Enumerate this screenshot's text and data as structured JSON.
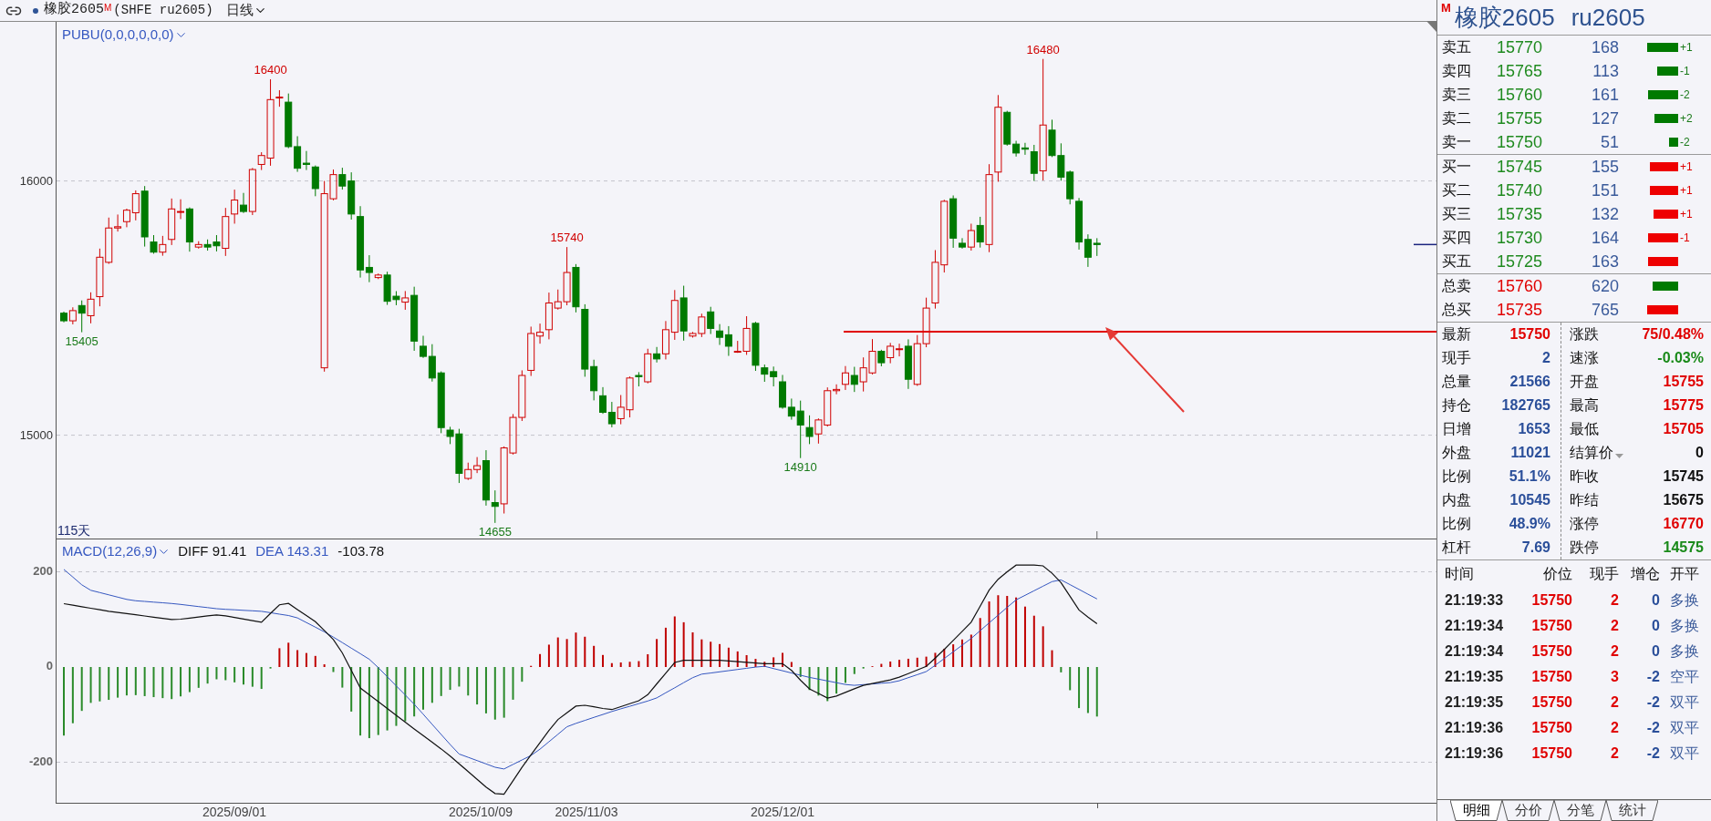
{
  "toolbar": {
    "contract": "橡胶2605",
    "market_mark": "M",
    "exchange_code": "(SHFE ru2605)",
    "period": "日线"
  },
  "price_chart": {
    "indicator": "PUBU(0,0,0,0,0,0)",
    "bar_count": "115天",
    "y_ticks": [
      "16000",
      "15000"
    ],
    "extremes": [
      {
        "text": "15405",
        "kind": "low"
      },
      {
        "text": "16400",
        "kind": "high"
      },
      {
        "text": "14655",
        "kind": "low"
      },
      {
        "text": "15740",
        "kind": "high"
      },
      {
        "text": "14910",
        "kind": "low"
      },
      {
        "text": "16480",
        "kind": "high"
      }
    ]
  },
  "macd_chart": {
    "indicator": "MACD(12,26,9)",
    "readings": [
      {
        "text": "DIFF 91.41",
        "kind": "diff"
      },
      {
        "text": "DEA 143.31",
        "kind": "dea"
      },
      {
        "text": "-103.78",
        "kind": "macd"
      }
    ],
    "y_ticks": [
      "200",
      "0",
      "-200"
    ]
  },
  "x_axis": {
    "labels": [
      "2025/09/01",
      "2025/10/09",
      "2025/11/03",
      "2025/12/01"
    ]
  },
  "quote_panel": {
    "market_mark": "M",
    "name": "橡胶2605",
    "code": "ru2605",
    "asks": [
      {
        "label": "卖五",
        "price": "15770",
        "volume": "168",
        "change": "+1"
      },
      {
        "label": "卖四",
        "price": "15765",
        "volume": "113",
        "change": "-1"
      },
      {
        "label": "卖三",
        "price": "15760",
        "volume": "161",
        "change": "-2"
      },
      {
        "label": "卖二",
        "price": "15755",
        "volume": "127",
        "change": "+2"
      },
      {
        "label": "卖一",
        "price": "15750",
        "volume": "51",
        "change": "-2"
      }
    ],
    "bids": [
      {
        "label": "买一",
        "price": "15745",
        "volume": "155",
        "change": "+1"
      },
      {
        "label": "买二",
        "price": "15740",
        "volume": "151",
        "change": "+1"
      },
      {
        "label": "买三",
        "price": "15735",
        "volume": "132",
        "change": "+1"
      },
      {
        "label": "买四",
        "price": "15730",
        "volume": "164",
        "change": "-1"
      },
      {
        "label": "买五",
        "price": "15725",
        "volume": "163"
      }
    ],
    "totals": [
      {
        "label": "总卖",
        "price": "15760",
        "volume": "620",
        "kind": "sell"
      },
      {
        "label": "总买",
        "price": "15735",
        "volume": "765",
        "kind": "buy"
      }
    ],
    "stats_left": [
      {
        "label": "最新",
        "value": "15750",
        "color": "#e00000"
      },
      {
        "label": "现手",
        "value": "2",
        "color": "#2b4f9a"
      },
      {
        "label": "总量",
        "value": "21566",
        "color": "#2b4f9a"
      },
      {
        "label": "持仓",
        "value": "182765",
        "color": "#2b4f9a"
      },
      {
        "label": "日增",
        "value": "1653",
        "color": "#2b4f9a"
      },
      {
        "label": "外盘",
        "value": "11021",
        "color": "#2b4f9a"
      },
      {
        "label": "比例",
        "value": "51.1%",
        "color": "#2b4f9a"
      },
      {
        "label": "内盘",
        "value": "10545",
        "color": "#2b4f9a"
      },
      {
        "label": "比例",
        "value": "48.9%",
        "color": "#2b4f9a"
      },
      {
        "label": "杠杆",
        "value": "7.69",
        "color": "#2b4f9a"
      }
    ],
    "stats_right": [
      {
        "label": "涨跌",
        "value": "75/0.48%",
        "color": "#e00000",
        "kind": "plain"
      },
      {
        "label": "速涨",
        "value": "-0.03%",
        "color": "#1a8a1a",
        "kind": "plain"
      },
      {
        "label": "开盘",
        "value": "15755",
        "color": "#e00000",
        "kind": "plain"
      },
      {
        "label": "最高",
        "value": "15775",
        "color": "#e00000",
        "kind": "plain"
      },
      {
        "label": "最低",
        "value": "15705",
        "color": "#e00000",
        "kind": "plain"
      },
      {
        "label": "结算价",
        "value": "0",
        "color": "#111111",
        "kind": "dropdown"
      },
      {
        "label": "昨收",
        "value": "15745",
        "color": "#111111",
        "kind": "plain"
      },
      {
        "label": "昨结",
        "value": "15675",
        "color": "#111111",
        "kind": "plain"
      },
      {
        "label": "涨停",
        "value": "16770",
        "color": "#e00000",
        "kind": "plain"
      },
      {
        "label": "跌停",
        "value": "14575",
        "color": "#1a8a1a",
        "kind": "plain"
      }
    ]
  },
  "trades": {
    "columns": [
      "时间",
      "价位",
      "现手",
      "增仓",
      "开平"
    ],
    "rows": [
      {
        "time": "21:19:33",
        "price": "15750",
        "hand": "2",
        "oi_change": "0",
        "type": "多换"
      },
      {
        "time": "21:19:34",
        "price": "15750",
        "hand": "2",
        "oi_change": "0",
        "type": "多换"
      },
      {
        "time": "21:19:34",
        "price": "15750",
        "hand": "2",
        "oi_change": "0",
        "type": "多换"
      },
      {
        "time": "21:19:35",
        "price": "15750",
        "hand": "3",
        "oi_change": "-2",
        "type": "空平"
      },
      {
        "time": "21:19:35",
        "price": "15750",
        "hand": "2",
        "oi_change": "-2",
        "type": "双平"
      },
      {
        "time": "21:19:36",
        "price": "15750",
        "hand": "2",
        "oi_change": "-2",
        "type": "双平"
      },
      {
        "time": "21:19:36",
        "price": "15750",
        "hand": "2",
        "oi_change": "-2",
        "type": "双平"
      }
    ]
  },
  "tabs": [
    {
      "label": "明细",
      "selected": true
    },
    {
      "label": "分价",
      "selected": false
    },
    {
      "label": "分笔",
      "selected": false
    },
    {
      "label": "统计",
      "selected": false
    }
  ]
}
